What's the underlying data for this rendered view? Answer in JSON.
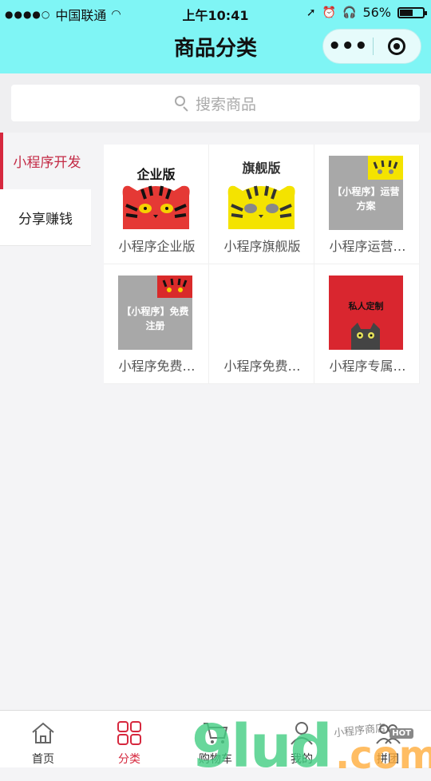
{
  "status": {
    "carrier": "中国联通",
    "time": "上午10:41",
    "battery": "56%",
    "battery_level": 0.56
  },
  "nav": {
    "title": "商品分类"
  },
  "search": {
    "placeholder": "搜索商品"
  },
  "sidebar": {
    "items": [
      {
        "label": "小程序开发",
        "active": true
      },
      {
        "label": "分享赚钱",
        "active": false
      }
    ]
  },
  "products": [
    {
      "name": "小程序企业版",
      "thumb_text": "企业版",
      "color": "#e53935"
    },
    {
      "name": "小程序旗舰版",
      "thumb_text": "旗舰版",
      "color": "#f4e300"
    },
    {
      "name": "小程序运营…",
      "thumb_text": "【小程序】运营方案",
      "color": "#a8a8a8"
    },
    {
      "name": "小程序免费…",
      "thumb_text": "【小程序】免费注册",
      "color": "#a8a8a8"
    },
    {
      "name": "小程序免费…",
      "thumb_text": "",
      "color": "#ffffff"
    },
    {
      "name": "小程序专属…",
      "thumb_text": "私人定制",
      "color": "#d9262f"
    }
  ],
  "tabbar": {
    "items": [
      {
        "label": "首页",
        "icon": "home-icon"
      },
      {
        "label": "分类",
        "icon": "category-icon"
      },
      {
        "label": "购物车",
        "icon": "cart-icon"
      },
      {
        "label": "我的",
        "icon": "user-icon"
      },
      {
        "label": "拼团",
        "icon": "group-icon",
        "badge": "HOT"
      }
    ]
  },
  "watermark": {
    "main": "9lud",
    "domain": ".com",
    "tagline": "小程序商店"
  },
  "colors": {
    "header": "#7ff5f5",
    "accent": "#d6283e"
  }
}
